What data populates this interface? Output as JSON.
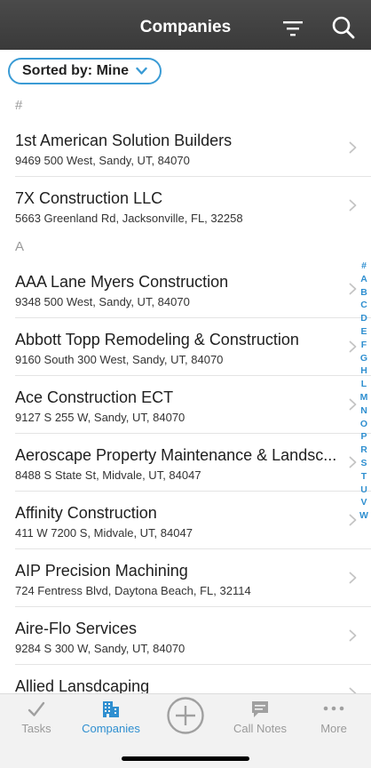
{
  "nav": {
    "title": "Companies",
    "filter_icon": "filter-icon",
    "search_icon": "search-icon"
  },
  "sort": {
    "label": "Sorted by: Mine"
  },
  "sections": [
    {
      "header": "#",
      "rows": [
        {
          "name": "1st American Solution Builders",
          "address": "9469 500 West, Sandy, UT, 84070"
        },
        {
          "name": "7X Construction LLC",
          "address": "5663 Greenland Rd, Jacksonville, FL, 32258"
        }
      ]
    },
    {
      "header": "A",
      "rows": [
        {
          "name": "AAA Lane Myers Construction",
          "address": "9348 500 West, Sandy, UT, 84070"
        },
        {
          "name": "Abbott Topp Remodeling & Construction",
          "address": "9160 South 300 West, Sandy, UT, 84070"
        },
        {
          "name": "Ace Construction ECT",
          "address": "9127 S 255 W, Sandy, UT, 84070"
        },
        {
          "name": "Aeroscape Property Maintenance & Landsc...",
          "address": "8488 S State St, Midvale, UT, 84047"
        },
        {
          "name": "Affinity Construction",
          "address": "411 W 7200 S, Midvale, UT, 84047"
        },
        {
          "name": "AIP Precision Machining",
          "address": "724 Fentress Blvd, Daytona Beach, FL, 32114"
        },
        {
          "name": "Aire-Flo Services",
          "address": "9284 S 300 W, Sandy, UT, 84070"
        },
        {
          "name": "Allied Lansdcaping",
          "address": ""
        }
      ]
    }
  ],
  "index": [
    "#",
    "A",
    "B",
    "C",
    "D",
    "E",
    "F",
    "G",
    "H",
    "L",
    "M",
    "N",
    "O",
    "P",
    "R",
    "S",
    "T",
    "U",
    "V",
    "W"
  ],
  "tabs": [
    {
      "label": "Tasks",
      "icon": "checkmark-icon",
      "active": false
    },
    {
      "label": "Companies",
      "icon": "building-icon",
      "active": true
    },
    {
      "label": "",
      "icon": "add-circle-icon",
      "active": false
    },
    {
      "label": "Call Notes",
      "icon": "speech-bubble-icon",
      "active": false
    },
    {
      "label": "More",
      "icon": "more-dots-icon",
      "active": false
    }
  ],
  "colors": {
    "accent": "#2f8fd0",
    "navbar": "#3f3f3f",
    "pill_border": "#3a9bd5"
  }
}
